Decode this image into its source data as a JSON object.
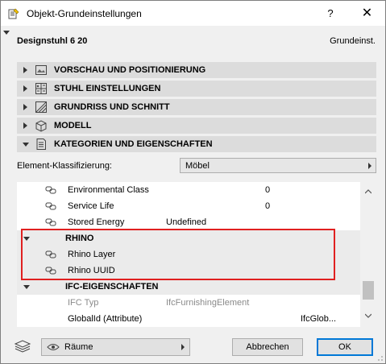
{
  "window": {
    "title": "Objekt-Grundeinstellungen",
    "help_label": "?",
    "close_label": "✕"
  },
  "object": {
    "name": "Designstuhl 6 20",
    "category": "Grundeinst."
  },
  "panels": [
    {
      "label": "VORSCHAU UND POSITIONIERUNG",
      "icon": "preview-icon",
      "expanded": false
    },
    {
      "label": "STUHL EINSTELLUNGEN",
      "icon": "settings-grid-icon",
      "expanded": false
    },
    {
      "label": "GRUNDRISS UND SCHNITT",
      "icon": "floorplan-icon",
      "expanded": false
    },
    {
      "label": "MODELL",
      "icon": "cube-icon",
      "expanded": false
    },
    {
      "label": "KATEGORIEN UND EIGENSCHAFTEN",
      "icon": "document-icon",
      "expanded": true
    }
  ],
  "classification": {
    "label": "Element-Klassifizierung:",
    "value": "Möbel"
  },
  "properties": {
    "rows": [
      {
        "type": "prop",
        "name": "Environmental Class",
        "value": "",
        "value2": "0"
      },
      {
        "type": "prop",
        "name": "Service Life",
        "value": "",
        "value2": "0"
      },
      {
        "type": "prop",
        "name": "Stored Energy",
        "value": "Undefined",
        "value2": ""
      },
      {
        "type": "group",
        "name": "RHINO"
      },
      {
        "type": "prop",
        "name": "Rhino Layer",
        "value": "",
        "value2": ""
      },
      {
        "type": "prop",
        "name": "Rhino UUID",
        "value": "",
        "value2": ""
      },
      {
        "type": "group",
        "name": "IFC-EIGENSCHAFTEN"
      },
      {
        "type": "prop-grey",
        "name": "IFC Typ",
        "value": "IfcFurnishingElement",
        "value2": ""
      },
      {
        "type": "prop-noicon",
        "name": "GlobalId (Attribute)",
        "value": "",
        "value3": "IfcGlob..."
      }
    ]
  },
  "footer": {
    "layer_value": "Räume",
    "cancel_label": "Abbrechen",
    "ok_label": "OK"
  },
  "colors": {
    "highlight": "#e02020",
    "panel_header": "#dcdcdc",
    "ok_border": "#0078d7"
  }
}
